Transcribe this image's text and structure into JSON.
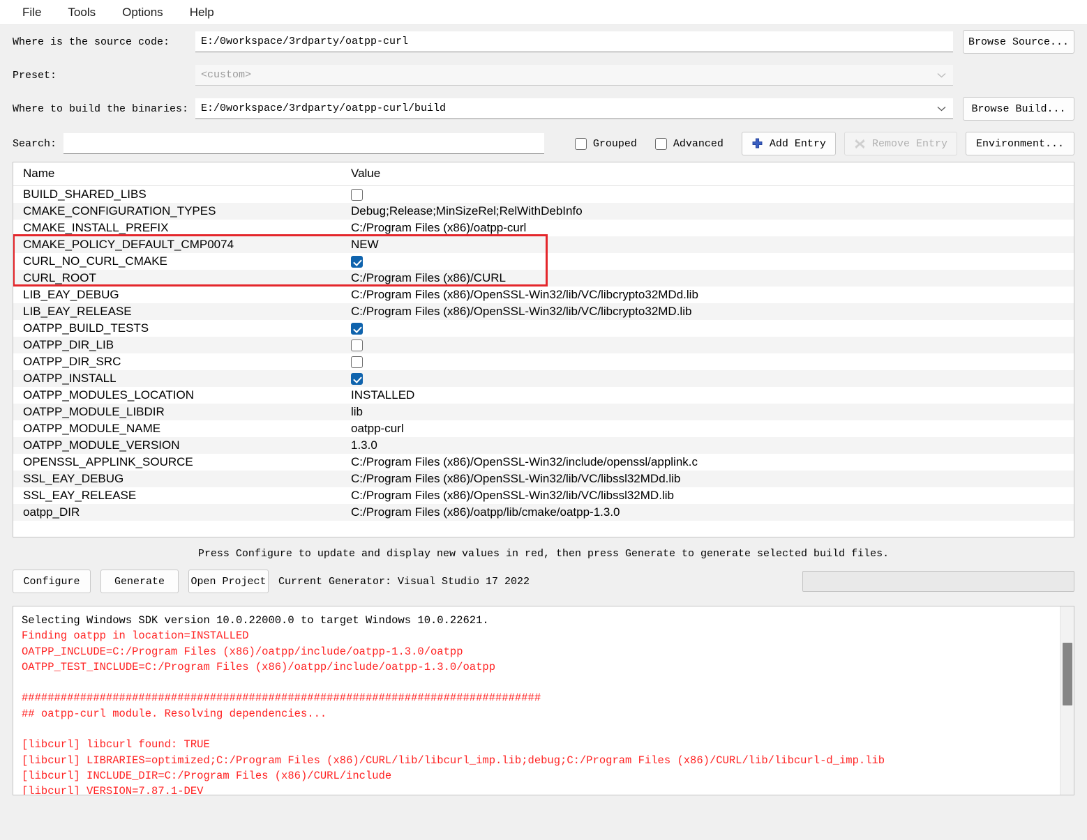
{
  "menu": {
    "items": [
      {
        "label": "File",
        "name": "menu-file"
      },
      {
        "label": "Tools",
        "name": "menu-tools"
      },
      {
        "label": "Options",
        "name": "menu-options"
      },
      {
        "label": "Help",
        "name": "menu-help"
      }
    ]
  },
  "form": {
    "source_label": "Where is the source code:",
    "source_value": "E:/0workspace/3rdparty/oatpp-curl",
    "browse_source_label": "Browse Source...",
    "preset_label": "Preset:",
    "preset_value": "<custom>",
    "build_label": "Where to build the binaries:",
    "build_value": "E:/0workspace/3rdparty/oatpp-curl/build",
    "browse_build_label": "Browse Build..."
  },
  "search": {
    "label": "Search:",
    "value": "",
    "placeholder": "",
    "grouped_label": "Grouped",
    "grouped_checked": false,
    "advanced_label": "Advanced",
    "advanced_checked": false,
    "add_entry_label": "Add Entry",
    "remove_entry_label": "Remove Entry",
    "remove_entry_disabled": true,
    "environment_label": "Environment..."
  },
  "table": {
    "headers": [
      "Name",
      "Value"
    ],
    "highlight_color": "#e4262b",
    "checkbox_color": "#0f63ad",
    "rows": [
      {
        "name": "BUILD_SHARED_LIBS",
        "type": "bool",
        "checked": false,
        "value": ""
      },
      {
        "name": "CMAKE_CONFIGURATION_TYPES",
        "type": "text",
        "value": "Debug;Release;MinSizeRel;RelWithDebInfo"
      },
      {
        "name": "CMAKE_INSTALL_PREFIX",
        "type": "text",
        "value": "C:/Program Files (x86)/oatpp-curl"
      },
      {
        "name": "CMAKE_POLICY_DEFAULT_CMP0074",
        "type": "text",
        "value": "NEW"
      },
      {
        "name": "CURL_NO_CURL_CMAKE",
        "type": "bool",
        "checked": true,
        "value": ""
      },
      {
        "name": "CURL_ROOT",
        "type": "text",
        "value": "C:/Program Files (x86)/CURL"
      },
      {
        "name": "LIB_EAY_DEBUG",
        "type": "text",
        "value": "C:/Program Files (x86)/OpenSSL-Win32/lib/VC/libcrypto32MDd.lib"
      },
      {
        "name": "LIB_EAY_RELEASE",
        "type": "text",
        "value": "C:/Program Files (x86)/OpenSSL-Win32/lib/VC/libcrypto32MD.lib"
      },
      {
        "name": "OATPP_BUILD_TESTS",
        "type": "bool",
        "checked": true,
        "value": ""
      },
      {
        "name": "OATPP_DIR_LIB",
        "type": "bool",
        "checked": false,
        "value": ""
      },
      {
        "name": "OATPP_DIR_SRC",
        "type": "bool",
        "checked": false,
        "value": ""
      },
      {
        "name": "OATPP_INSTALL",
        "type": "bool",
        "checked": true,
        "value": ""
      },
      {
        "name": "OATPP_MODULES_LOCATION",
        "type": "text",
        "value": "INSTALLED"
      },
      {
        "name": "OATPP_MODULE_LIBDIR",
        "type": "text",
        "value": "lib"
      },
      {
        "name": "OATPP_MODULE_NAME",
        "type": "text",
        "value": "oatpp-curl"
      },
      {
        "name": "OATPP_MODULE_VERSION",
        "type": "text",
        "value": "1.3.0"
      },
      {
        "name": "OPENSSL_APPLINK_SOURCE",
        "type": "text",
        "value": "C:/Program Files (x86)/OpenSSL-Win32/include/openssl/applink.c"
      },
      {
        "name": "SSL_EAY_DEBUG",
        "type": "text",
        "value": "C:/Program Files (x86)/OpenSSL-Win32/lib/VC/libssl32MDd.lib"
      },
      {
        "name": "SSL_EAY_RELEASE",
        "type": "text",
        "value": "C:/Program Files (x86)/OpenSSL-Win32/lib/VC/libssl32MD.lib"
      },
      {
        "name": "oatpp_DIR",
        "type": "text",
        "value": "C:/Program Files (x86)/oatpp/lib/cmake/oatpp-1.3.0"
      }
    ],
    "highlighted_rows": [
      "CMAKE_POLICY_DEFAULT_CMP0074",
      "CURL_NO_CURL_CMAKE",
      "CURL_ROOT"
    ]
  },
  "hint": "Press Configure to update and display new values in red, then press Generate to generate selected build files.",
  "actions": {
    "configure_label": "Configure",
    "generate_label": "Generate",
    "open_project_label": "Open Project",
    "generator_label": "Current Generator: Visual Studio 17 2022"
  },
  "log": {
    "lines": [
      {
        "text": "Selecting Windows SDK version 10.0.22000.0 to target Windows 10.0.22621.",
        "color": "black"
      },
      {
        "text": "Finding oatpp in location=INSTALLED",
        "color": "red"
      },
      {
        "text": "OATPP_INCLUDE=C:/Program Files (x86)/oatpp/include/oatpp-1.3.0/oatpp",
        "color": "red"
      },
      {
        "text": "OATPP_TEST_INCLUDE=C:/Program Files (x86)/oatpp/include/oatpp-1.3.0/oatpp",
        "color": "red"
      },
      {
        "text": "",
        "color": "red"
      },
      {
        "text": "################################################################################",
        "color": "red"
      },
      {
        "text": "## oatpp-curl module. Resolving dependencies...",
        "color": "red"
      },
      {
        "text": "",
        "color": "red"
      },
      {
        "text": "[libcurl] libcurl found: TRUE",
        "color": "red"
      },
      {
        "text": "[libcurl] LIBRARIES=optimized;C:/Program Files (x86)/CURL/lib/libcurl_imp.lib;debug;C:/Program Files (x86)/CURL/lib/libcurl-d_imp.lib",
        "color": "red"
      },
      {
        "text": "[libcurl] INCLUDE_DIR=C:/Program Files (x86)/CURL/include",
        "color": "red"
      },
      {
        "text": "[libcurl] VERSION=7.87.1-DEV",
        "color": "red"
      }
    ]
  }
}
